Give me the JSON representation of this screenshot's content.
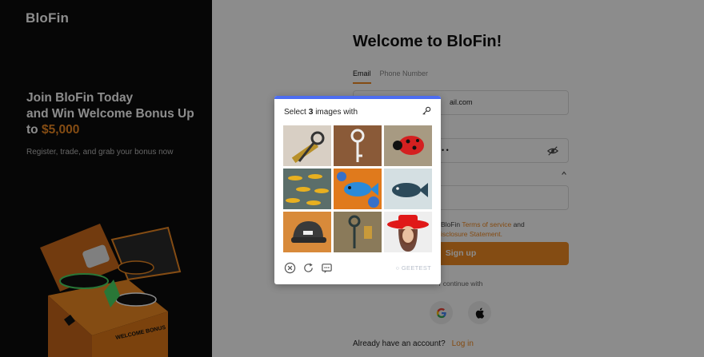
{
  "brand": {
    "logo_text": "BloFin",
    "accent": "#f08a24"
  },
  "promo": {
    "title_line1": "Join BloFin Today",
    "title_line2": "and Win Welcome Bonus Up",
    "title_to": "to",
    "title_amount": "$5,000",
    "subtitle": "Register, trade, and grab your bonus now",
    "box_text": "WELCOME BONUS"
  },
  "form": {
    "heading": "Welcome to BloFin!",
    "tabs": [
      "Email",
      "Phone Number"
    ],
    "active_tab": "Email",
    "email_value": "ail.com",
    "password_value": "•  •",
    "terms_prefix": "BloFin",
    "terms_link1": "Terms of service",
    "terms_and": "and",
    "terms_link2": "isclosure Statement.",
    "signup_label": "Sign up",
    "continue_label": "r continue with",
    "have_account": "Already have an account?",
    "login_label": "Log in"
  },
  "captcha": {
    "prompt_before": "Select",
    "prompt_count": "3",
    "prompt_after": "images with",
    "tiles": [
      "key",
      "key",
      "ladybug",
      "fish",
      "fish",
      "fish",
      "hat",
      "key",
      "hat"
    ],
    "brand": "GEETEST",
    "accent": "#4c6df1"
  }
}
